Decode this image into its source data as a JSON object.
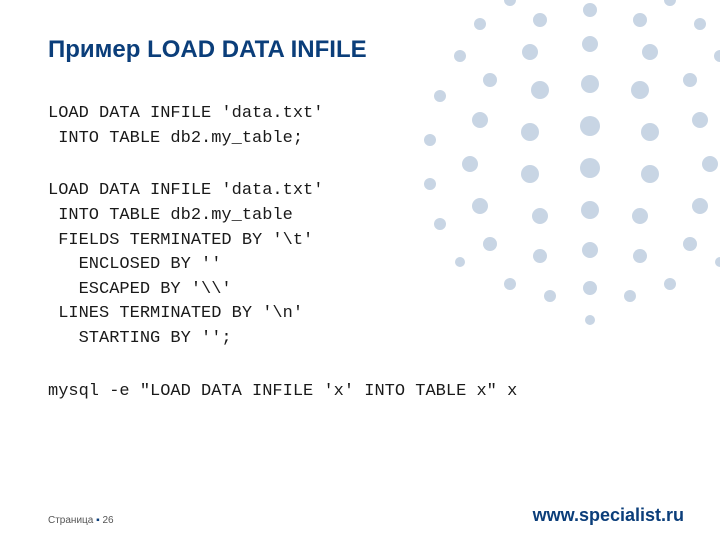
{
  "title": "Пример LOAD DATA INFILE",
  "code": {
    "block1": "LOAD DATA INFILE 'data.txt'\n INTO TABLE db2.my_table;",
    "block2": "LOAD DATA INFILE 'data.txt'\n INTO TABLE db2.my_table\n FIELDS TERMINATED BY '\\t'\n   ENCLOSED BY ''\n   ESCAPED BY '\\\\'\n LINES TERMINATED BY '\\n'\n   STARTING BY '';",
    "block3": "mysql -e \"LOAD DATA INFILE 'x' INTO TABLE x\" x"
  },
  "footer": {
    "page_prefix": "Страница",
    "bullet": "▪",
    "page_number": "26",
    "site": "www.specialist.ru"
  },
  "colors": {
    "primary": "#0b3e7a",
    "dot": "#8aa6c4"
  }
}
